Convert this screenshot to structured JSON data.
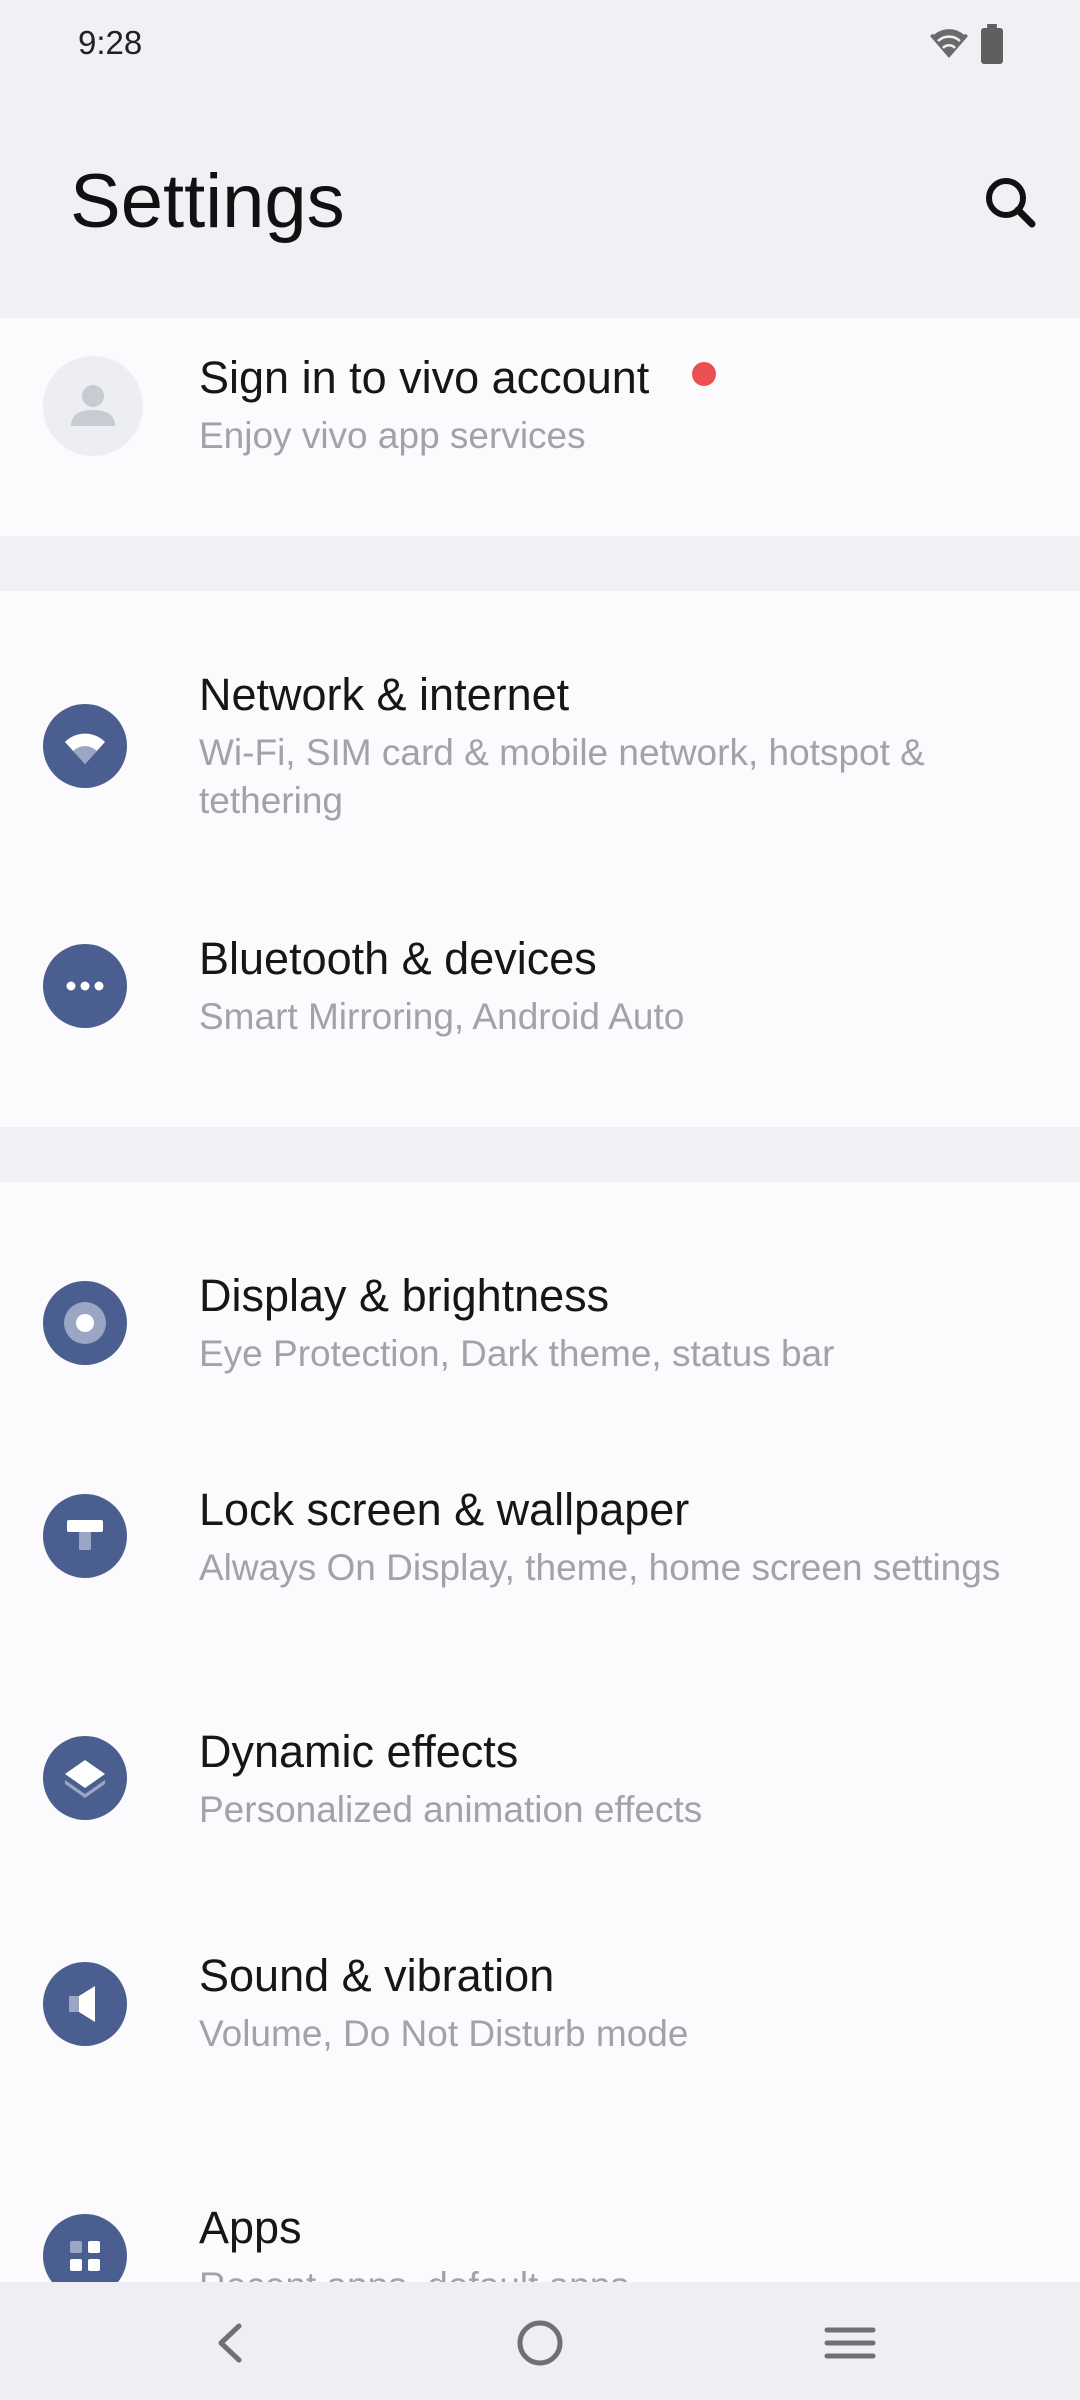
{
  "status_bar": {
    "time": "9:28",
    "icons": [
      "wifi-icon",
      "battery-icon"
    ]
  },
  "header": {
    "title": "Settings",
    "search_icon": "search-icon"
  },
  "account": {
    "title": "Sign in to vivo account",
    "subtitle": "Enjoy vivo app services",
    "badge_color": "#ea4f52",
    "icon": "avatar-icon"
  },
  "settings_groups": [
    {
      "items": [
        {
          "title": "Network & internet",
          "subtitle": "Wi-Fi, SIM card & mobile network, hotspot & tethering",
          "icon": "wifi-icon"
        },
        {
          "title": "Bluetooth & devices",
          "subtitle": "Smart Mirroring, Android Auto",
          "icon": "more-horiz-icon"
        }
      ]
    },
    {
      "items": [
        {
          "title": "Display & brightness",
          "subtitle": "Eye Protection, Dark theme, status bar",
          "icon": "brightness-icon"
        },
        {
          "title": "Lock screen & wallpaper",
          "subtitle": "Always On Display, theme, home screen settings",
          "icon": "paint-roller-icon"
        },
        {
          "title": "Dynamic effects",
          "subtitle": "Personalized animation effects",
          "icon": "layers-icon"
        },
        {
          "title": "Sound & vibration",
          "subtitle": "Volume, Do Not Disturb mode",
          "icon": "speaker-icon"
        },
        {
          "title": "Apps",
          "subtitle": "Recent apps, default apps",
          "icon": "apps-grid-icon"
        }
      ]
    }
  ],
  "nav_bar": {
    "buttons": [
      "back-icon",
      "home-icon",
      "menu-icon"
    ]
  },
  "colors": {
    "background": "#f1f0f5",
    "card": "#fbfafd",
    "icon_bg": "#4a5f8f",
    "title_text": "#161616",
    "subtitle_text": "#a2a2a8"
  }
}
